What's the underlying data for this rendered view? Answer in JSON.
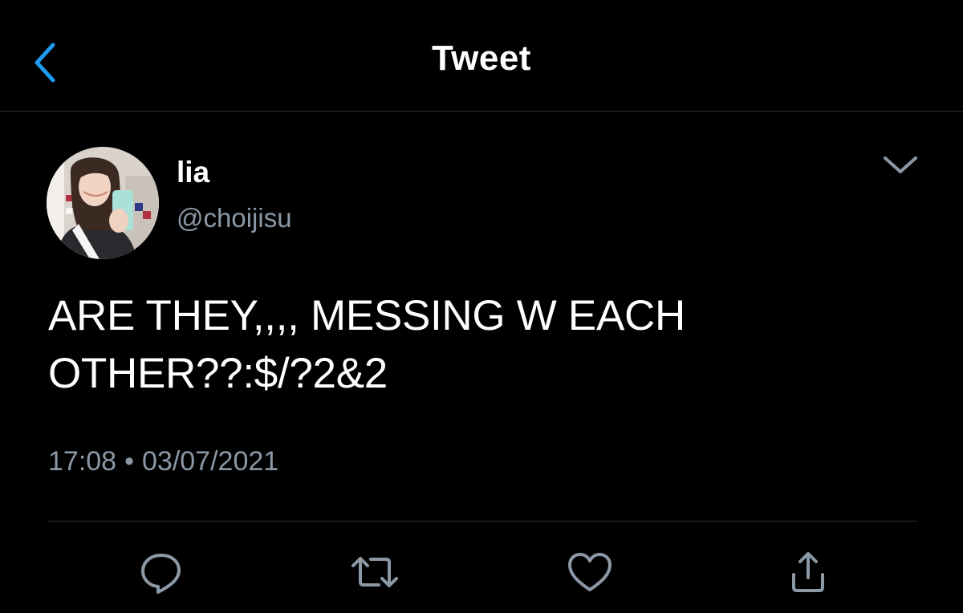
{
  "header": {
    "title": "Tweet",
    "back_icon": "chevron-left-icon",
    "accent_color": "#1d9bf0"
  },
  "tweet": {
    "author": {
      "name": "lia",
      "handle": "@choijisu"
    },
    "text": "ARE THEY,,,, MESSING W EACH\nOTHER??:$/?2&2",
    "time": "17:08",
    "separator": "•",
    "date": "03/07/2021",
    "menu_icon": "chevron-down-icon"
  },
  "actions": [
    {
      "name": "reply",
      "icon": "reply-icon"
    },
    {
      "name": "retweet",
      "icon": "retweet-icon"
    },
    {
      "name": "like",
      "icon": "heart-icon"
    },
    {
      "name": "share",
      "icon": "share-icon"
    }
  ],
  "colors": {
    "background": "#000000",
    "text_primary": "#ffffff",
    "text_secondary": "#8b98a5",
    "divider": "#2f3336"
  }
}
